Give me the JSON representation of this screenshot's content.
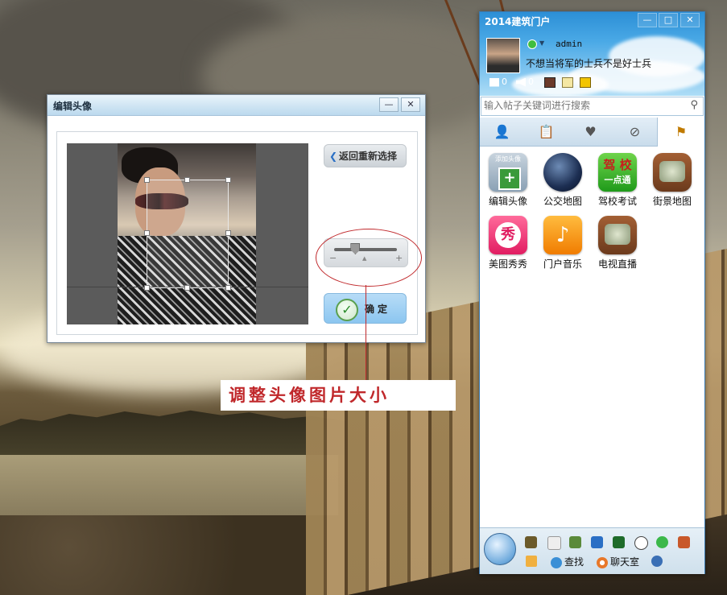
{
  "editor_window": {
    "title": "编辑头像",
    "minimize_label": "—",
    "close_label": "✕",
    "back_button_label": "返回重新选择",
    "zoom_minus": "−",
    "zoom_plus": "+",
    "zoom_level": 0.3,
    "confirm_label": "确定"
  },
  "annotation": {
    "callout_text": "调整头像图片大小"
  },
  "messenger": {
    "title": "2014建筑门户",
    "minimize_label": "—",
    "maximize_label": "□",
    "close_label": "✕",
    "username": "admin",
    "signature": "不想当将军的士兵不是好士兵",
    "mail_count": "0",
    "sound_count": "0",
    "search": {
      "placeholder": "输入帖子关键词进行搜索"
    },
    "tabs": [
      {
        "icon": "contacts-icon",
        "glyph": "👤"
      },
      {
        "icon": "notes-icon",
        "glyph": "📋"
      },
      {
        "icon": "heart-icon",
        "glyph": "♥"
      },
      {
        "icon": "compass-icon",
        "glyph": "⊘"
      },
      {
        "icon": "signpost-icon",
        "glyph": "⚑"
      }
    ],
    "apps": [
      {
        "label": "编辑头像",
        "icon": "edit-avatar-icon",
        "badge": "添加头像"
      },
      {
        "label": "公交地图",
        "icon": "globe-icon"
      },
      {
        "label": "驾校考试",
        "icon": "driving-school-icon",
        "badge": "驾 校",
        "badge2": "一点通"
      },
      {
        "label": "街景地图",
        "icon": "tv-map-icon"
      },
      {
        "label": "美图秀秀",
        "icon": "meitu-icon",
        "badge": "秀"
      },
      {
        "label": "门户音乐",
        "icon": "music-icon",
        "badge": "♪"
      },
      {
        "label": "电视直播",
        "icon": "tv-icon"
      }
    ],
    "bottom": {
      "find_label": "查找",
      "chat_label": "聊天室"
    }
  },
  "colors": {
    "accent_blue": "#2c8fd6",
    "annotation_red": "#c0282b",
    "confirm_bg": "#8cc6f0"
  }
}
